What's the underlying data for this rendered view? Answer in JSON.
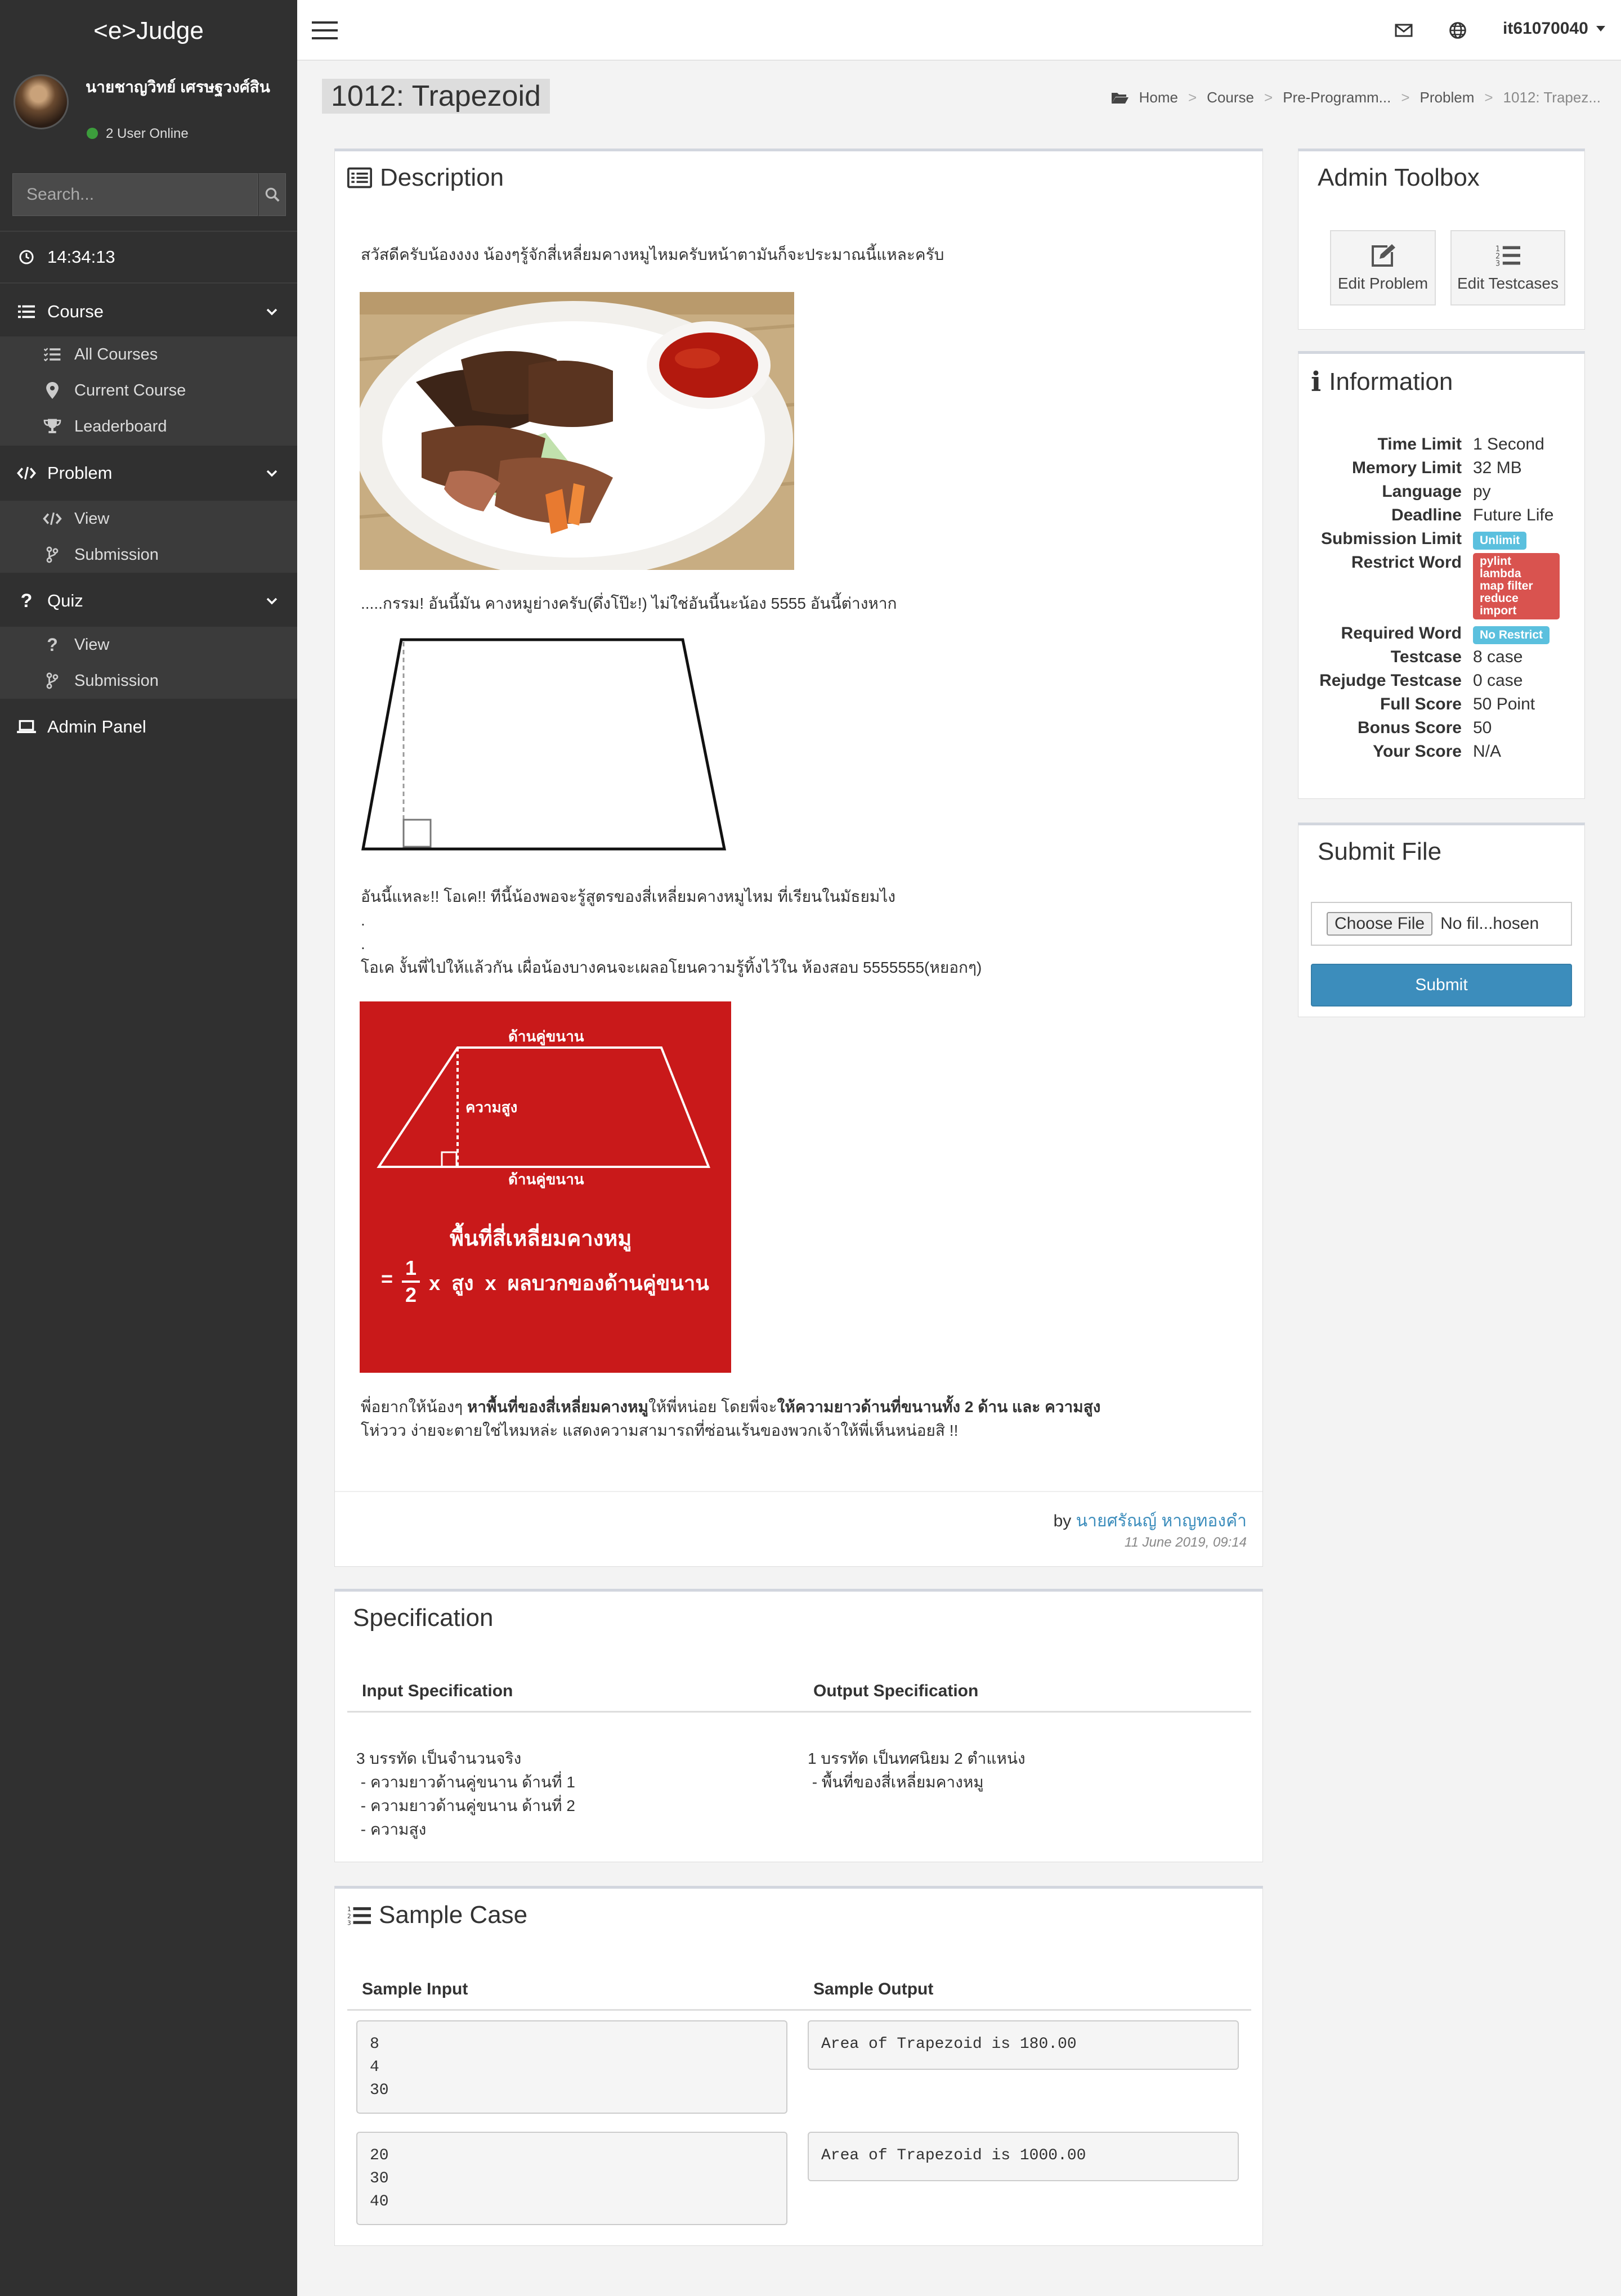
{
  "sidebar": {
    "logo": "<e>Judge",
    "user_name": "นายชาญวิทย์ เศรษฐวงศ์สิน",
    "online_text": "2 User Online",
    "search_placeholder": "Search...",
    "time": "14:34:13",
    "course_label": "Course",
    "course_items": [
      "All Courses",
      "Current Course",
      "Leaderboard"
    ],
    "problem_label": "Problem",
    "problem_items": [
      "View",
      "Submission"
    ],
    "quiz_label": "Quiz",
    "quiz_items": [
      "View",
      "Submission"
    ],
    "admin_label": "Admin Panel"
  },
  "topbar": {
    "username": "it61070040"
  },
  "page": {
    "title": "1012: Trapezoid",
    "breadcrumb": [
      "Home",
      "Course",
      "Pre-Programm...",
      "Problem",
      "1012: Trapez..."
    ]
  },
  "description": {
    "heading": "Description",
    "p1": "สวัสดีครับน้องงงง น้องๆรู้จักสี่เหลี่ยมคางหมูไหมครับหน้าตามันก็จะประมาณนี้แหละครับ",
    "p2": ".....กรรม! อันนี้มัน คางหมูย่างครับ(ดึ่งโป๊ะ!) ไม่ใช่อันนี้นะน้อง 5555 อันนี้ต่างหาก",
    "p3": "อันนี้แหละ!! โอเค!! ทีนี้น้องพอจะรู้สูตรของสี่เหลี่ยมคางหมูไหม ที่เรียนในมัธยมไง",
    "p3a": ".",
    "p3b": ".",
    "p4": "โอเค งั้นพี่ไปให้แล้วกัน เผื่อน้องบางคนจะเผลอโยนความรู้ทิ้งไว้ใน ห้องสอบ 5555555(หยอกๆ)",
    "formula": {
      "top_label": "ด้านคู่ขนาน",
      "height_label": "ความสูง",
      "bottom_label": "ด้านคู่ขนาน",
      "title": "พื้นที่สี่เหลี่ยมคางหมู",
      "eq": "=",
      "num": "1",
      "den": "2",
      "rest": "x  สูง  x  ผลบวกของด้านคู่ขนาน"
    },
    "p5_a": "พี่อยากให้น้องๆ ",
    "p5_b": "หาพื้นที่ของสี่เหลี่ยมคางหมู",
    "p5_c": "ให้พี่หน่อย โดยพี่จะ",
    "p5_d": "ให้ความยาวด้านที่ขนานทั้ง 2 ด้าน และ ความสูง",
    "p6": "โห่ววว ง่ายจะตายใช่ไหมหล่ะ แสดงความสามารถที่ซ่อนเร้นของพวกเจ้าให้พี่เห็นหน่อยสิ !!",
    "by": "by",
    "author": "นายศรัณญ์ หาญทองคำ",
    "date": "11 June 2019, 09:14"
  },
  "spec": {
    "heading": "Specification",
    "input_header": "Input Specification",
    "output_header": "Output Specification",
    "input_lines": [
      "3 บรรทัด เป็นจำนวนจริง",
      " - ความยาวด้านคู่ขนาน ด้านที่ 1",
      " - ความยาวด้านคู่ขนาน ด้านที่ 2",
      " - ความสูง"
    ],
    "output_lines": [
      "1 บรรทัด เป็นทศนิยม 2 ตำแหน่ง",
      " - พื้นที่ของสี่เหลี่ยมคางหมู"
    ]
  },
  "sample": {
    "heading": "Sample Case",
    "input_header": "Sample Input",
    "output_header": "Sample Output",
    "cases": [
      {
        "input": "8\n4\n30",
        "output": "Area of Trapezoid is 180.00"
      },
      {
        "input": "20\n30\n40",
        "output": "Area of Trapezoid is 1000.00"
      }
    ]
  },
  "toolbox": {
    "heading": "Admin Toolbox",
    "edit_problem": "Edit Problem",
    "edit_testcases": "Edit Testcases"
  },
  "information": {
    "heading": "Information",
    "time_limit_k": "Time Limit",
    "time_limit_v": "1 Second",
    "memory_limit_k": "Memory Limit",
    "memory_limit_v": "32 MB",
    "language_k": "Language",
    "language_v": "py",
    "deadline_k": "Deadline",
    "deadline_v": "Future Life",
    "submission_limit_k": "Submission Limit",
    "submission_limit_v": "Unlimit",
    "restrict_word_k": "Restrict Word",
    "restrict_words": [
      "pylint",
      "lambda",
      "map filter",
      "reduce",
      "import"
    ],
    "required_word_k": "Required Word",
    "required_word_v": "No Restrict",
    "testcase_k": "Testcase",
    "testcase_v": "8 case",
    "rejudge_k": "Rejudge Testcase",
    "rejudge_v": "0 case",
    "full_score_k": "Full Score",
    "full_score_v": "50 Point",
    "bonus_score_k": "Bonus Score",
    "bonus_score_v": "50",
    "your_score_k": "Your Score",
    "your_score_v": "N/A"
  },
  "submit": {
    "heading": "Submit File",
    "choose_label": "Choose File",
    "no_file": "No fil...hosen",
    "button": "Submit"
  },
  "colors": {
    "sidebar": "#303030",
    "submit": "#3c8dbc",
    "badge_info": "#5bc0de",
    "badge_danger": "#d9534f",
    "formula_bg": "#c9191a",
    "link": "#3c8dbc"
  }
}
